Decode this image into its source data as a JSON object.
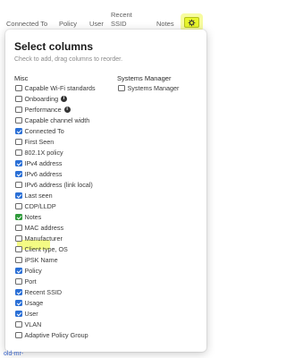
{
  "table_header": {
    "columns": [
      {
        "label": "Connected To"
      },
      {
        "label": "Policy"
      },
      {
        "label": "User"
      },
      {
        "label_line1": "Recent",
        "label_line2": "SSID"
      },
      {
        "label": "Notes"
      }
    ],
    "settings_icon": "gear-icon"
  },
  "panel": {
    "title": "Select columns",
    "subtitle": "Check to add, drag columns to reorder."
  },
  "groups": {
    "misc": {
      "title": "Misc",
      "items": [
        {
          "label": "Capable Wi-Fi standards",
          "checked": false
        },
        {
          "label": "Onboarding",
          "checked": false,
          "info": true
        },
        {
          "label": "Performance",
          "checked": false,
          "info": true
        },
        {
          "label": "Capable channel width",
          "checked": false
        },
        {
          "label": "Connected To",
          "checked": true
        },
        {
          "label": "First Seen",
          "checked": false
        },
        {
          "label": "802.1X policy",
          "checked": false
        },
        {
          "label": "IPv4 address",
          "checked": true
        },
        {
          "label": "IPv6 address",
          "checked": true
        },
        {
          "label": "IPv6 address (link local)",
          "checked": false
        },
        {
          "label": "Last seen",
          "checked": true
        },
        {
          "label": "CDP/LLDP",
          "checked": false
        },
        {
          "label": "Notes",
          "checked": true,
          "highlight": true
        },
        {
          "label": "MAC address",
          "checked": false
        },
        {
          "label": "Manufacturer",
          "checked": false
        },
        {
          "label": "Client type, OS",
          "checked": false
        },
        {
          "label": "iPSK Name",
          "checked": false
        },
        {
          "label": "Policy",
          "checked": true
        },
        {
          "label": "Port",
          "checked": false
        },
        {
          "label": "Recent SSID",
          "checked": true
        },
        {
          "label": "Usage",
          "checked": true
        },
        {
          "label": "User",
          "checked": true
        },
        {
          "label": "VLAN",
          "checked": false
        },
        {
          "label": "Adaptive Policy Group",
          "checked": false
        }
      ]
    },
    "systems_manager": {
      "title": "Systems Manager",
      "items": [
        {
          "label": "Systems Manager",
          "checked": false
        }
      ]
    }
  },
  "info_glyph": "i",
  "below_text": "old-mr-",
  "colors": {
    "checkbox_checked": "#2a6fd6",
    "highlight": "#e8f62a",
    "notes_checkbox": "#2e9a3a"
  }
}
